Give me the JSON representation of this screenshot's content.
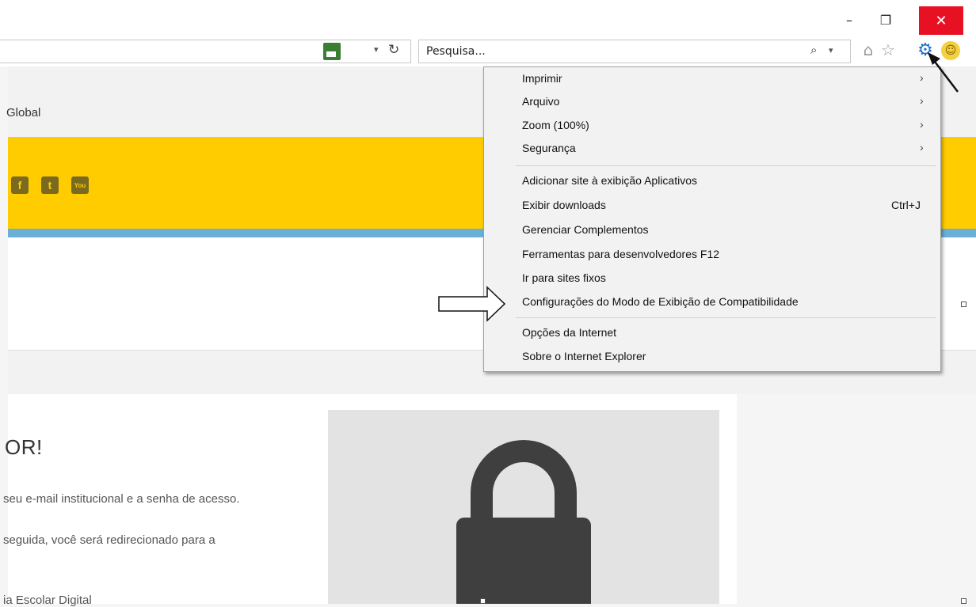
{
  "window": {
    "minimize": "–",
    "restore": "❐",
    "close": "✕"
  },
  "toolbar": {
    "address_dropdown": "▾",
    "refresh": "↻",
    "search_placeholder": "Pesquisa...",
    "search_icon": "⌕",
    "search_dropdown": "▾",
    "home_icon": "⌂",
    "favorites_icon": "☆",
    "tools_icon": "⚙",
    "feedback_icon": "☺"
  },
  "page": {
    "nav_text": "Global",
    "social": [
      "f",
      "t",
      "You"
    ],
    "card_title": "OR!",
    "card_lines": [
      "seu e-mail institucional e a senha de acesso.",
      "seguida, você será redirecionado para a",
      "ia Escolar Digital"
    ]
  },
  "menu": {
    "items": [
      {
        "label": "Imprimir",
        "submenu": "›"
      },
      {
        "label": "Arquivo",
        "submenu": "›"
      },
      {
        "label": "Zoom (100%)",
        "submenu": "›"
      },
      {
        "label": "Segurança",
        "submenu": "›"
      },
      {
        "label": "Adicionar site à exibição Aplicativos"
      },
      {
        "label": "Exibir downloads",
        "shortcut": "Ctrl+J"
      },
      {
        "label": "Gerenciar Complementos"
      },
      {
        "label": "Ferramentas para desenvolvedores F12"
      },
      {
        "label": "Ir para sites fixos"
      },
      {
        "label": "Configurações do Modo de Exibição de Compatibilidade"
      },
      {
        "label": "Opções da Internet"
      },
      {
        "label": "Sobre o Internet Explorer"
      }
    ]
  },
  "colors": {
    "close_red": "#e81123",
    "banner_yellow": "#ffcc00",
    "accent_blue": "#6aafd8",
    "gear_blue": "#1e6fc9"
  }
}
